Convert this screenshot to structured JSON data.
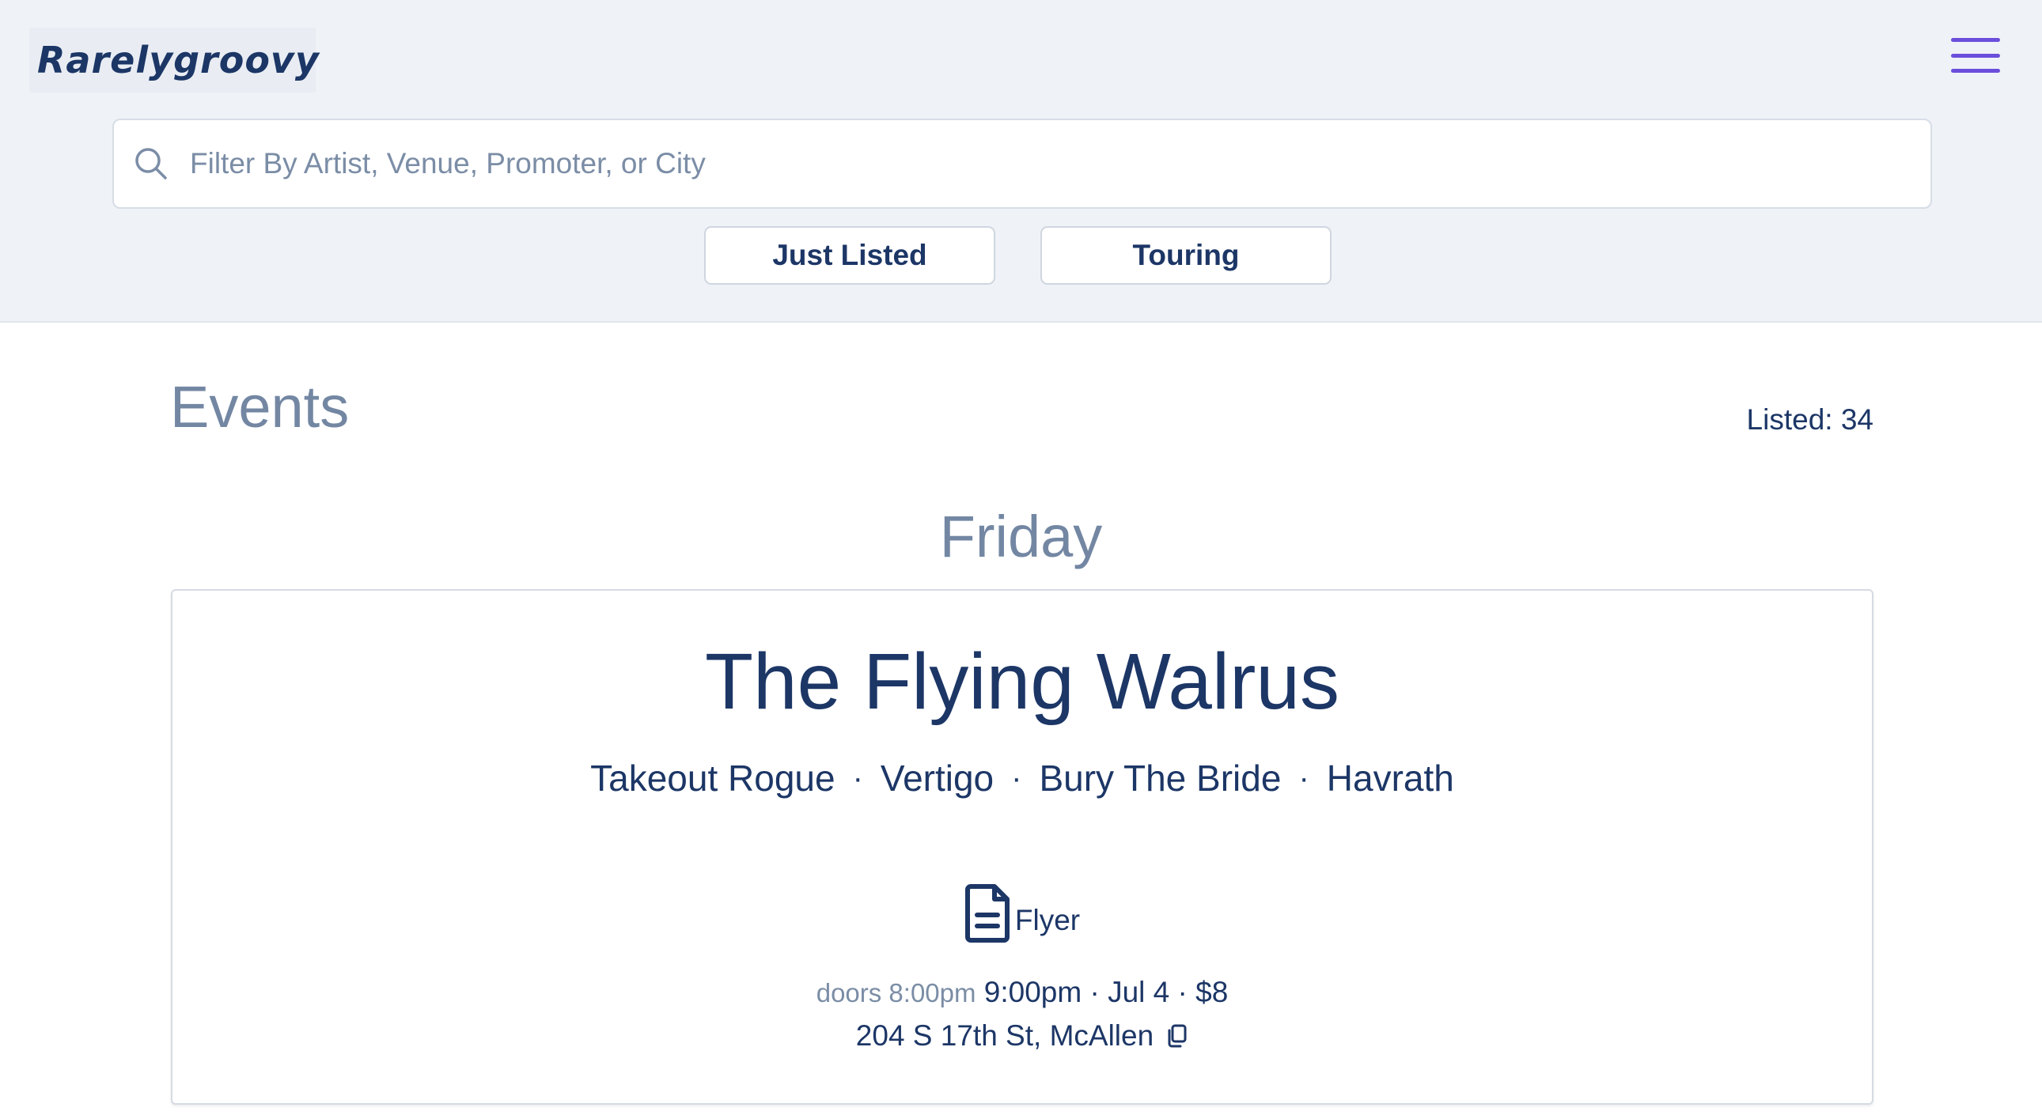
{
  "brand": {
    "name": "Rarelygroovy",
    "accent_color": "#6b4fdc",
    "text_color": "#1c3666"
  },
  "header": {
    "menu_icon": "hamburger-menu-icon",
    "search": {
      "placeholder": "Filter By Artist, Venue, Promoter, or City",
      "value": "",
      "icon": "search-icon"
    },
    "filters": [
      {
        "label": "Just Listed"
      },
      {
        "label": "Touring"
      }
    ]
  },
  "main": {
    "title": "Events",
    "listed_count": "Listed: 34",
    "days": [
      {
        "label": "Friday",
        "events": [
          {
            "venue": "The Flying Walrus",
            "artists": [
              "Takeout Rogue",
              "Vertigo",
              "Bury The Bride",
              "Havrath"
            ],
            "artist_separator": "·",
            "flyer_label": "Flyer",
            "doors": "doors 8:00pm",
            "details": "9:00pm · Jul 4 · $8",
            "address": "204 S 17th St, McAllen"
          }
        ]
      }
    ]
  }
}
